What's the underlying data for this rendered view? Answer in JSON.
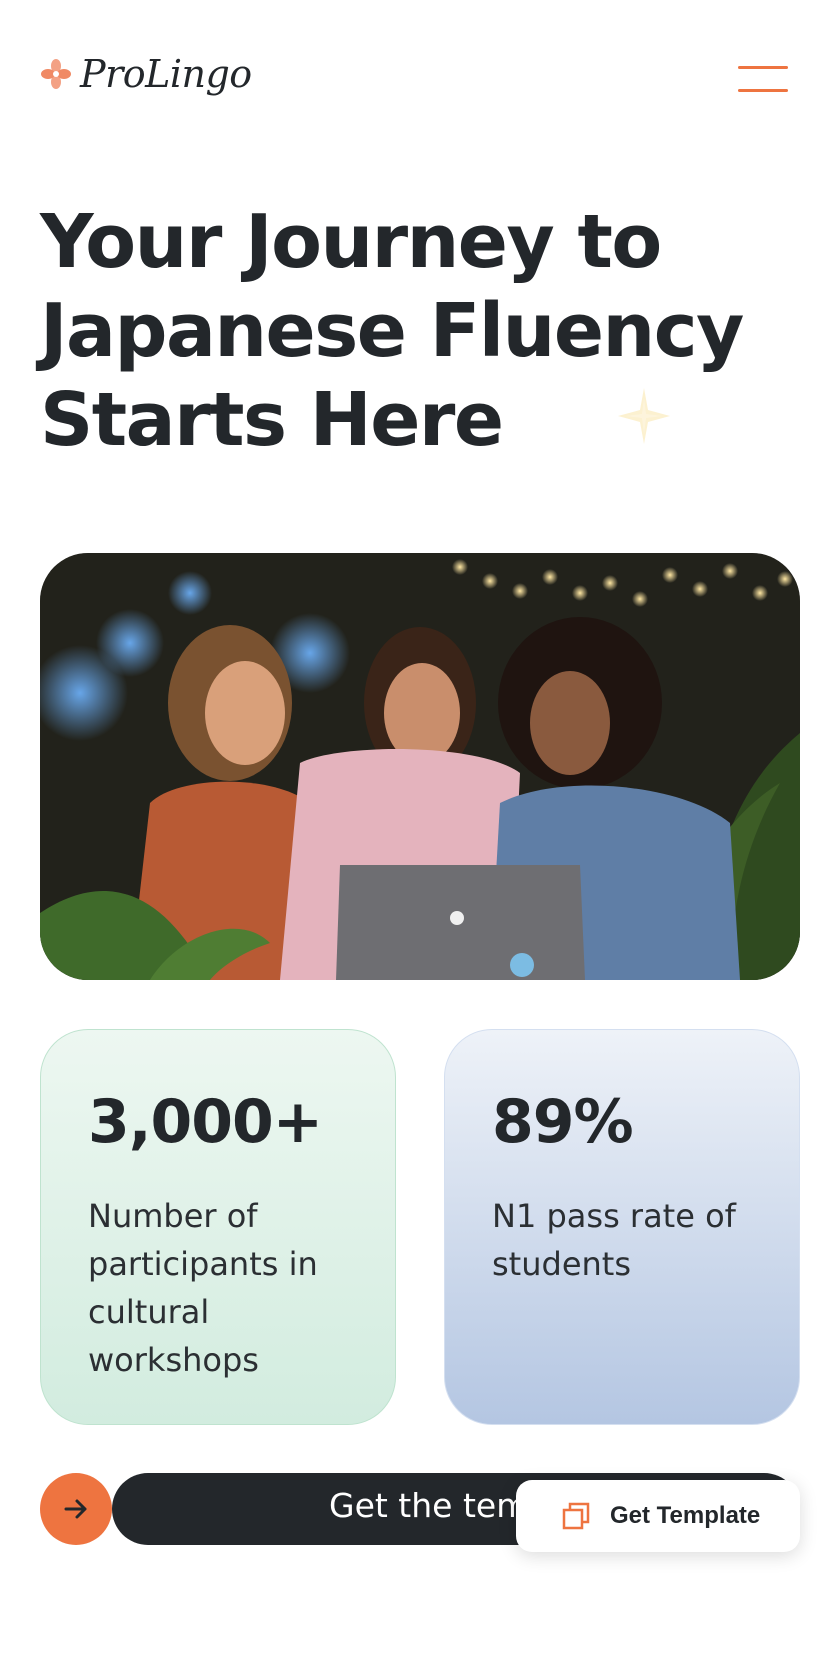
{
  "header": {
    "logo_text": "ProLingo",
    "logo_icon": "flower-icon",
    "menu_icon": "hamburger-menu-icon"
  },
  "hero": {
    "title_line1": "Your Journey to",
    "title_line2": "Japanese Fluency",
    "title_line3": "Starts Here"
  },
  "stats": [
    {
      "value": "3,000+",
      "desc_lines": [
        "Number of",
        "participants in",
        "cultural",
        "workshops"
      ]
    },
    {
      "value": "89%",
      "desc_lines": [
        "N1 pass rate of",
        "students"
      ]
    }
  ],
  "cta": {
    "arrow_icon": "arrow-right-icon",
    "label": "Get the temp"
  },
  "floating_button": {
    "icon": "copy-icon",
    "label": "Get Template"
  },
  "colors": {
    "accent": "#ee7440",
    "text": "#23272b",
    "card_green": "#d2ecdf",
    "card_blue": "#b4c6e2"
  }
}
